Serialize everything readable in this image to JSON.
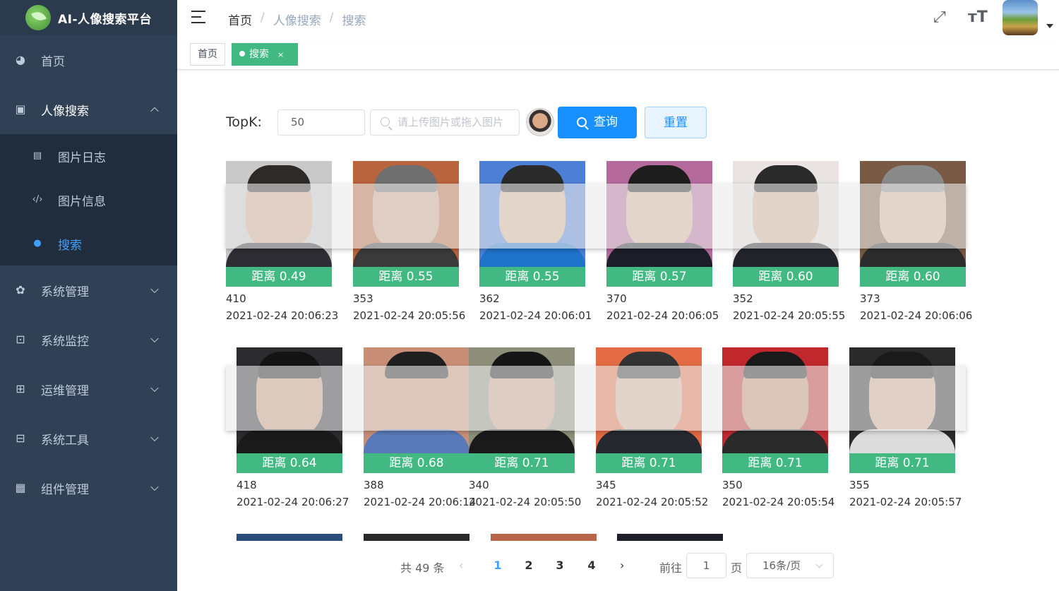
{
  "app": {
    "title": "AI-人像搜索平台"
  },
  "sidebar": {
    "items": [
      {
        "label": "首页",
        "icon": "dashboard-icon"
      },
      {
        "label": "人像搜索",
        "icon": "image-icon",
        "open": true,
        "children": [
          {
            "label": "图片日志",
            "icon": "log-icon"
          },
          {
            "label": "图片信息",
            "icon": "code-icon"
          },
          {
            "label": "搜索",
            "icon": "peoples-icon",
            "active": true
          }
        ]
      },
      {
        "label": "系统管理",
        "icon": "gear-icon"
      },
      {
        "label": "系统监控",
        "icon": "monitor-icon"
      },
      {
        "label": "运维管理",
        "icon": "server-icon"
      },
      {
        "label": "系统工具",
        "icon": "toolbox-icon"
      },
      {
        "label": "组件管理",
        "icon": "grid-icon"
      }
    ]
  },
  "header": {
    "breadcrumb": [
      "首页",
      "人像搜索",
      "搜索"
    ],
    "icons": [
      "fullscreen-icon",
      "font-size-icon"
    ]
  },
  "tags": [
    {
      "label": "首页"
    },
    {
      "label": "搜索",
      "active": true,
      "close": "×"
    }
  ],
  "search": {
    "topk_label": "TopK:",
    "topk_value": "50",
    "upload_placeholder": "请上传图片或拖入图片",
    "query_button": "查询",
    "reset_button": "重置"
  },
  "results": [
    {
      "distance": "距离 0.49",
      "id": "410",
      "time": "2021-02-24 20:06:23"
    },
    {
      "distance": "距离 0.55",
      "id": "353",
      "time": "2021-02-24 20:05:56"
    },
    {
      "distance": "距离 0.55",
      "id": "362",
      "time": "2021-02-24 20:06:01"
    },
    {
      "distance": "距离 0.57",
      "id": "370",
      "time": "2021-02-24 20:06:05"
    },
    {
      "distance": "距离 0.60",
      "id": "352",
      "time": "2021-02-24 20:05:55"
    },
    {
      "distance": "距离 0.60",
      "id": "373",
      "time": "2021-02-24 20:06:06"
    },
    {
      "distance": "距离 0.64",
      "id": "418",
      "time": "2021-02-24 20:06:27"
    },
    {
      "distance": "距离 0.68",
      "id": "388",
      "time": "2021-02-24 20:06:14"
    },
    {
      "distance": "距离 0.71",
      "id": "340",
      "time": "2021-02-24 20:05:50"
    },
    {
      "distance": "距离 0.71",
      "id": "345",
      "time": "2021-02-24 20:05:52"
    },
    {
      "distance": "距离 0.71",
      "id": "350",
      "time": "2021-02-24 20:05:54"
    },
    {
      "distance": "距离 0.71",
      "id": "355",
      "time": "2021-02-24 20:05:57"
    }
  ],
  "pagination": {
    "total": "共 49 条",
    "pages": [
      "1",
      "2",
      "3",
      "4"
    ],
    "current": "1",
    "goto_label": "前往",
    "goto_value": "1",
    "page_unit": "页",
    "page_size": "16条/页"
  },
  "colors": {
    "sidebar": "#304156",
    "accent": "#409eff",
    "tag_active": "#42b983",
    "primary_button": "#1890ff"
  }
}
